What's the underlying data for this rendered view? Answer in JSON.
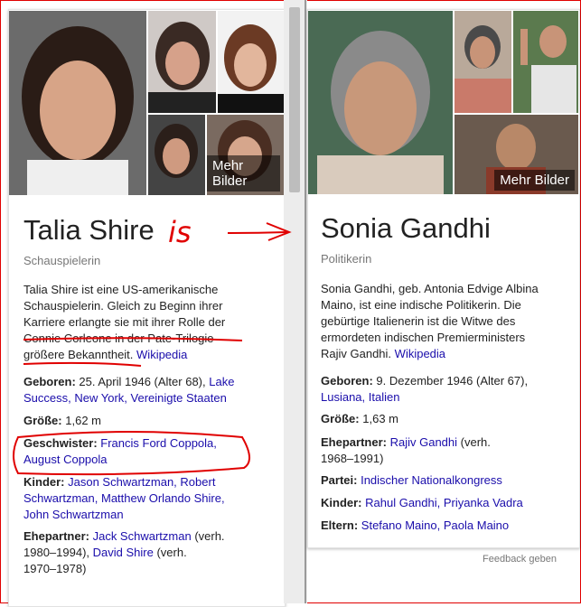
{
  "left": {
    "more_images": "Mehr Bilder",
    "name": "Talia Shire",
    "subtitle": "Schauspielerin",
    "desc": [
      "Talia Shire ist eine US-amerikanische",
      "Schauspielerin. Gleich zu Beginn ihrer",
      "Karriere erlangte sie mit ihrer Rolle der",
      "Connie Corleone in der Pate-Trilogie",
      "größere Bekanntheit."
    ],
    "wiki": "Wikipedia",
    "born_label": "Geboren:",
    "born_text": "25. April 1946 (Alter 68),",
    "born_link1": "Lake",
    "born_link2": "Success,",
    "born_link3": "New York,",
    "born_link4": "Vereinigte Staaten",
    "height_label": "Größe:",
    "height_value": "1,62 m",
    "siblings_label": "Geschwister:",
    "siblings_link1": "Francis Ford Coppola,",
    "siblings_link2": "August Coppola",
    "children_label": "Kinder:",
    "children_link1": "Jason Schwartzman,",
    "children_link2": "Robert",
    "children_link3": "Schwartzman,",
    "children_link4": "Matthew Orlando Shire,",
    "children_link5": "John Schwartzman",
    "spouse_label": "Ehepartner:",
    "spouse_link1": "Jack Schwartzman",
    "spouse_text1": "(verh.",
    "spouse_text2": "1980–1994),",
    "spouse_link2": "David Shire",
    "spouse_text3": "(verh.",
    "spouse_text4": "1970–1978)"
  },
  "right": {
    "more_images": "Mehr Bilder",
    "name": "Sonia Gandhi",
    "subtitle": "Politikerin",
    "desc": [
      "Sonia Gandhi, geb. Antonia Edvige Albina",
      "Maino, ist eine indische Politikerin. Die",
      "gebürtige Italienerin ist die Witwe des",
      "ermordeten indischen Premierministers",
      "Rajiv Gandhi."
    ],
    "wiki": "Wikipedia",
    "born_label": "Geboren:",
    "born_text": "9. Dezember 1946 (Alter 67),",
    "born_link1": "Lusiana,",
    "born_link2": "Italien",
    "height_label": "Größe:",
    "height_value": "1,63 m",
    "spouse_label": "Ehepartner:",
    "spouse_link": "Rajiv Gandhi",
    "spouse_text1": "(verh.",
    "spouse_text2": "1968–1991)",
    "party_label": "Partei:",
    "party_link": "Indischer Nationalkongress",
    "children_label": "Kinder:",
    "children_link1": "Rahul Gandhi,",
    "children_link2": "Priyanka Vadra",
    "parents_label": "Eltern:",
    "parents_link1": "Stefano Maino,",
    "parents_link2": "Paola Maino"
  },
  "feedback": "Feedback geben",
  "annotation": "is",
  "colors": {
    "link": "#1a0dab",
    "annotation": "#e00000"
  }
}
